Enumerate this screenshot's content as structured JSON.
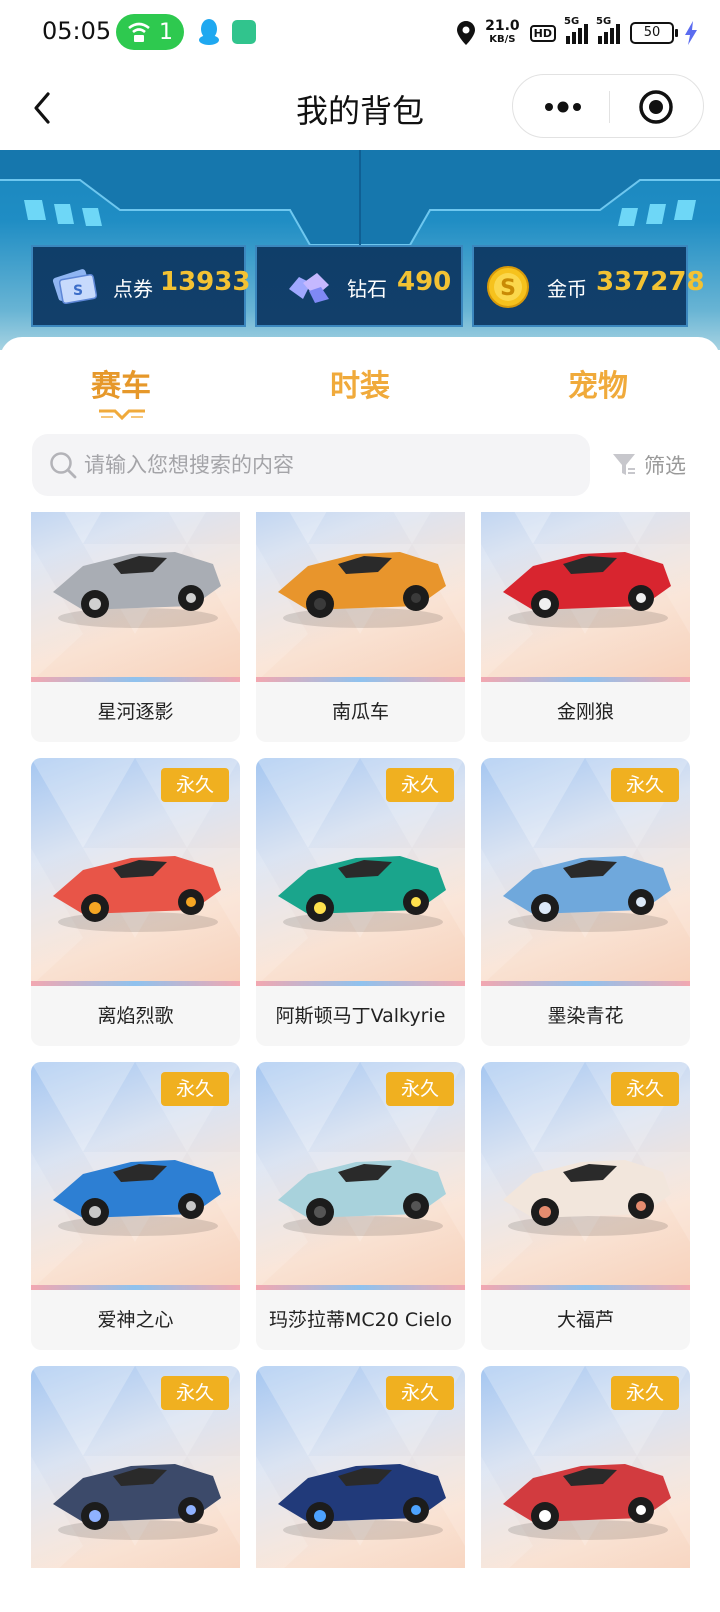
{
  "status_bar": {
    "time": "05:05",
    "hotspot_count": "1",
    "net_speed": "21.0",
    "net_speed_unit": "KB/S",
    "hd_label": "HD",
    "sim1_label": "5G",
    "sim2_label": "5G",
    "battery": "50"
  },
  "nav": {
    "title": "我的背包"
  },
  "currencies": [
    {
      "label": "点券",
      "value": "13933"
    },
    {
      "label": "钻石",
      "value": "490"
    },
    {
      "label": "金币",
      "value": "337278"
    }
  ],
  "tabs": [
    {
      "label": "赛车",
      "active": true
    },
    {
      "label": "时装",
      "active": false
    },
    {
      "label": "宠物",
      "active": false
    }
  ],
  "search": {
    "placeholder": "请输入您想搜索的内容"
  },
  "filter": {
    "label": "筛选"
  },
  "items": [
    {
      "name": "星河逐影",
      "badge": ""
    },
    {
      "name": "南瓜车",
      "badge": ""
    },
    {
      "name": "金刚狼",
      "badge": ""
    },
    {
      "name": "离焰烈歌",
      "badge": "永久"
    },
    {
      "name": "阿斯顿马丁Valkyrie",
      "badge": "永久"
    },
    {
      "name": "墨染青花",
      "badge": "永久"
    },
    {
      "name": "爱神之心",
      "badge": "永久"
    },
    {
      "name": "玛莎拉蒂MC20 Cielo",
      "badge": "永久"
    },
    {
      "name": "大福芦",
      "badge": "永久"
    },
    {
      "name": "",
      "badge": "永久"
    },
    {
      "name": "",
      "badge": "永久"
    },
    {
      "name": "",
      "badge": "永久"
    }
  ],
  "colors": {
    "accent_orange": "#f0aa3b",
    "badge_bg": "#f0b020",
    "banner_blue": "#1a86bd",
    "currency_value": "#f3c233"
  },
  "icons": [
    "back-arrow-icon",
    "more-dots-icon",
    "target-icon",
    "search-icon",
    "filter-icon",
    "ticket-icon",
    "diamond-icon",
    "gold-coin-icon"
  ]
}
